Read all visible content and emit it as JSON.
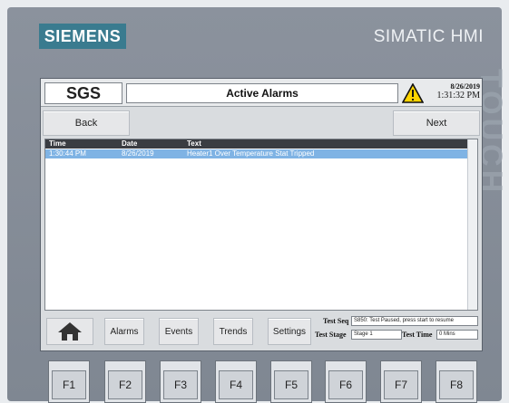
{
  "brand": {
    "left": "SIEMENS",
    "right": "SIMATIC HMI",
    "watermark": "TOUCH"
  },
  "header": {
    "logo": "SGS",
    "title": "Active Alarms",
    "warning_icon": "warning-triangle-icon",
    "date": "8/26/2019",
    "time": "1:31:32 PM"
  },
  "nav": {
    "back": "Back",
    "next": "Next"
  },
  "table": {
    "columns": [
      "Time",
      "Date",
      "Text"
    ],
    "rows": [
      {
        "time": "1:30:44 PM",
        "date": "8/26/2019",
        "text": "Heater1 Over Temperature Stat Tripped",
        "selected": true
      }
    ]
  },
  "bottom": {
    "home_icon": "home-icon",
    "buttons": [
      "Alarms",
      "Events",
      "Trends",
      "Settings"
    ],
    "test_seq_label": "Test Seq",
    "test_seq_value": "S850: Test Paused, press start to resume",
    "test_stage_label": "Test Stage",
    "test_stage_value": "Stage 1",
    "test_time_label": "Test Time",
    "test_time_value": "0 Mins"
  },
  "fkeys": [
    "F1",
    "F2",
    "F3",
    "F4",
    "F5",
    "F6",
    "F7",
    "F8"
  ],
  "colors": {
    "bezel": "#858c97",
    "brand_bg": "#3a7b8f",
    "selected_row": "#7fb3e4",
    "header_row": "#3a3d42"
  }
}
